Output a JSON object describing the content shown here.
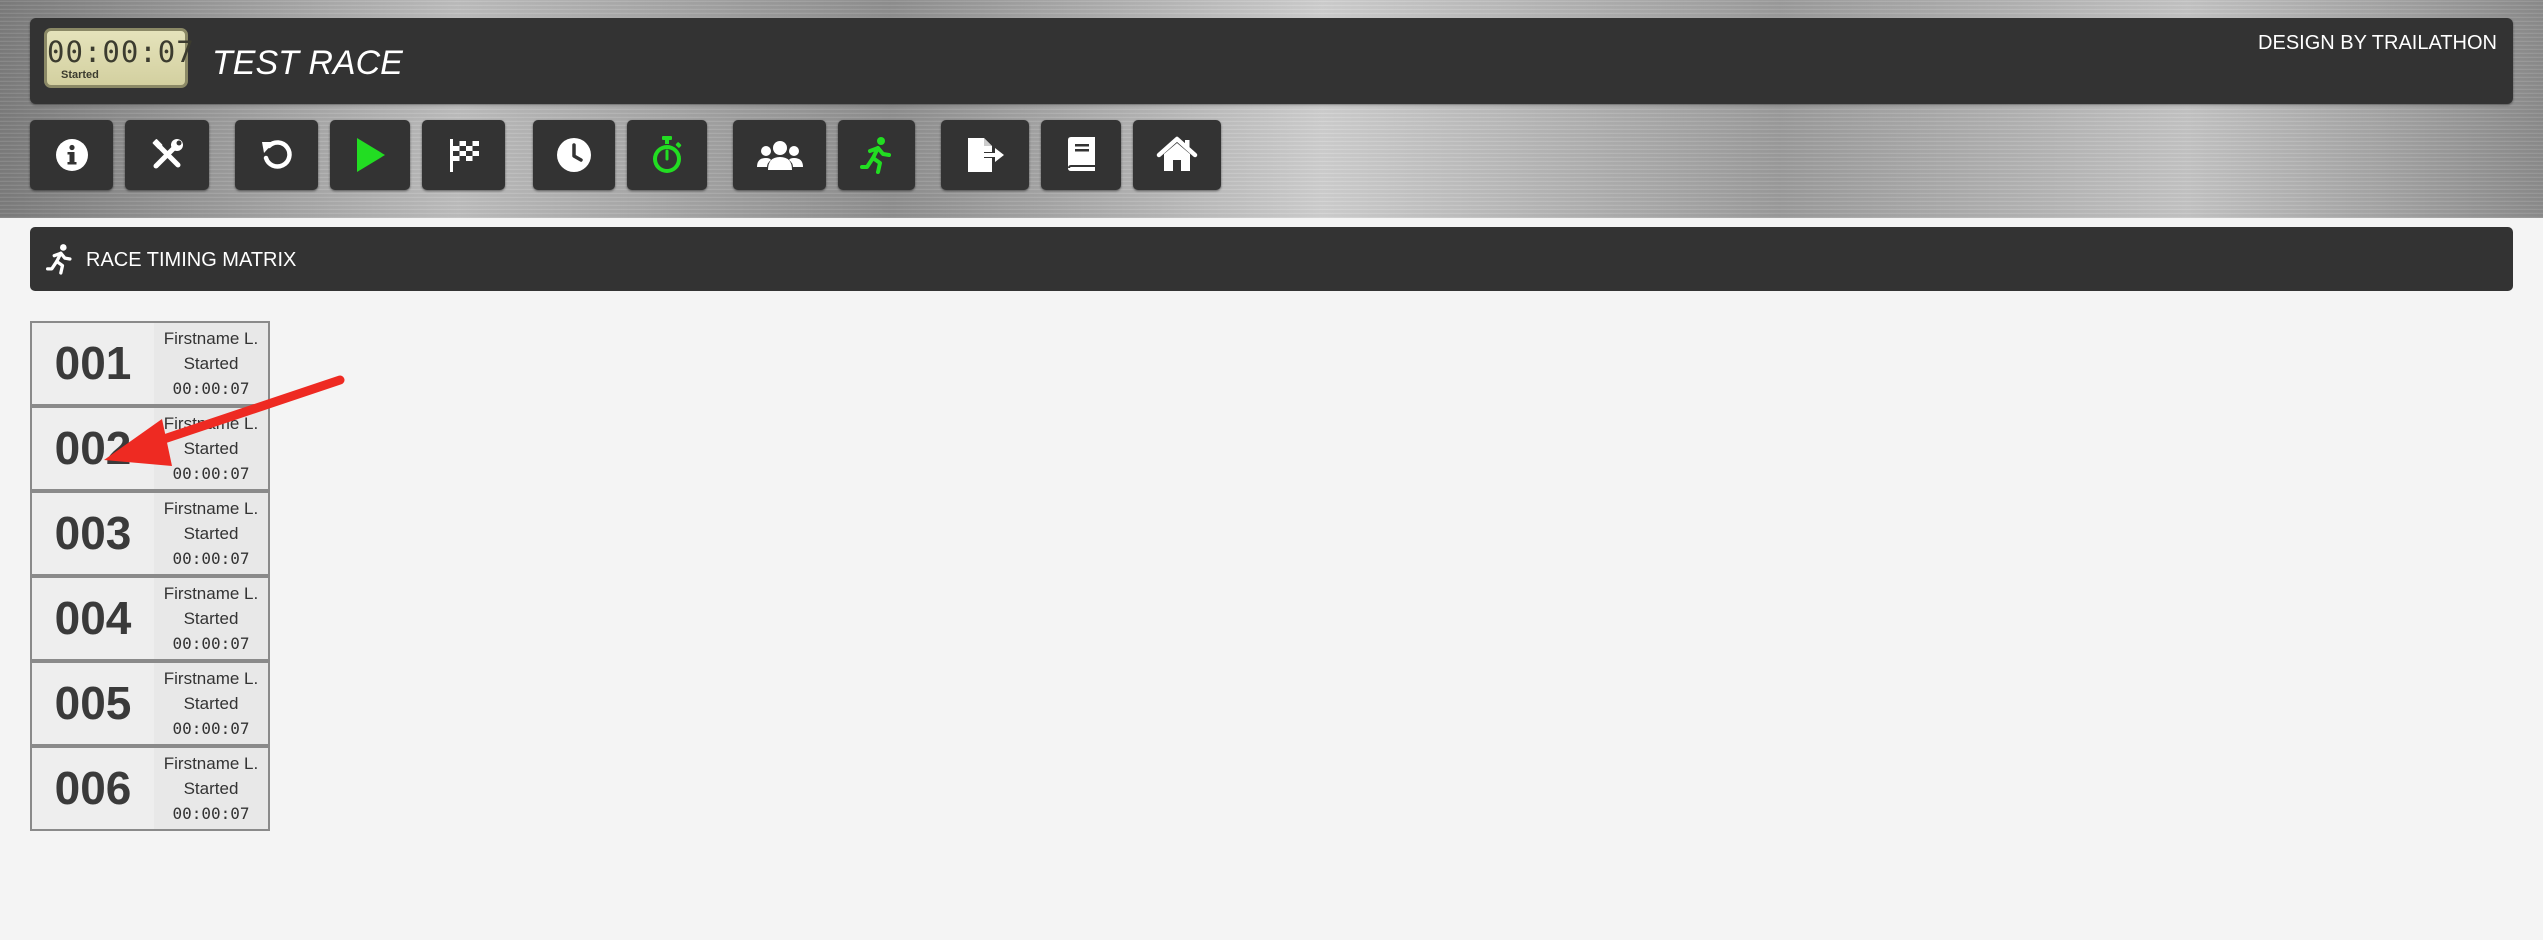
{
  "header": {
    "clock_time": "00:00:07",
    "clock_status": "Started",
    "race_title": "TEST RACE",
    "design_credit": "DESIGN BY TRAILATHON"
  },
  "toolbar": {
    "buttons": [
      {
        "icon": "info-icon"
      },
      {
        "icon": "tools-icon"
      },
      {
        "icon": "reset-icon"
      },
      {
        "icon": "play-icon"
      },
      {
        "icon": "checkered-flag-icon"
      },
      {
        "icon": "clock-icon"
      },
      {
        "icon": "stopwatch-icon"
      },
      {
        "icon": "users-icon"
      },
      {
        "icon": "runner-icon"
      },
      {
        "icon": "export-icon"
      },
      {
        "icon": "book-icon"
      },
      {
        "icon": "home-icon"
      }
    ],
    "accent_green": "#22dd22"
  },
  "section": {
    "title": "RACE TIMING MATRIX",
    "icon": "runner-icon"
  },
  "matrix": {
    "racers": [
      {
        "number": "001",
        "name": "Firstname L.",
        "status": "Started",
        "time": "00:00:07"
      },
      {
        "number": "002",
        "name": "Firstname L.",
        "status": "Started",
        "time": "00:00:07"
      },
      {
        "number": "003",
        "name": "Firstname L.",
        "status": "Started",
        "time": "00:00:07"
      },
      {
        "number": "004",
        "name": "Firstname L.",
        "status": "Started",
        "time": "00:00:07"
      },
      {
        "number": "005",
        "name": "Firstname L.",
        "status": "Started",
        "time": "00:00:07"
      },
      {
        "number": "006",
        "name": "Firstname L.",
        "status": "Started",
        "time": "00:00:07"
      }
    ]
  },
  "annotation": {
    "arrow_color": "#ee2a22"
  }
}
